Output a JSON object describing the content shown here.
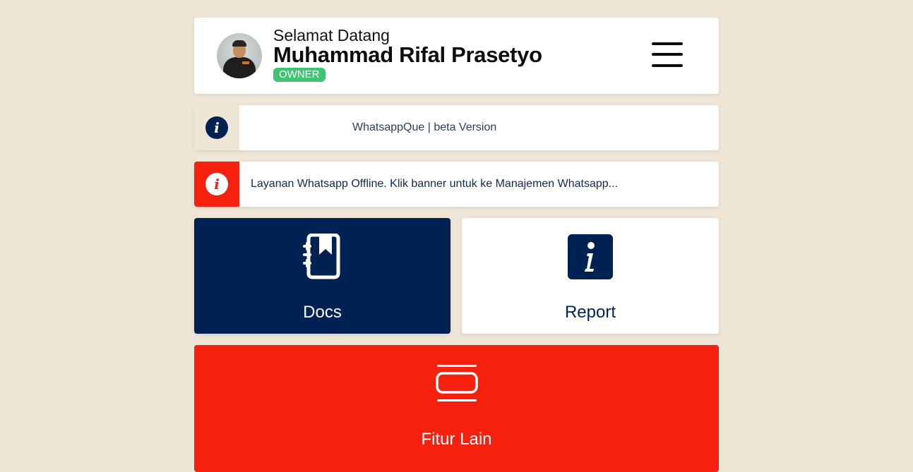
{
  "header": {
    "greeting": "Selamat Datang",
    "user_name": "Muhammad Rifal Prasetyo",
    "role_badge": "OWNER",
    "avatar_icon": "user-avatar",
    "menu_icon": "hamburger-menu-icon"
  },
  "info_banner": {
    "icon": "info-icon",
    "text": "WhatsappQue | beta Version",
    "icon_bg": "#002253",
    "side_bg": "#efe5d6"
  },
  "alert_banner": {
    "icon": "info-icon",
    "text": "Layanan Whatsapp Offline. Klik banner untuk ke Manajemen Whatsapp...",
    "side_bg": "#f5200e"
  },
  "tiles": [
    {
      "label": "Docs",
      "icon": "notebook-bookmark-icon",
      "bg": "#002253",
      "fg": "#ffffff"
    },
    {
      "label": "Report",
      "icon": "info-square-icon",
      "bg": "#ffffff",
      "fg": "#002253"
    }
  ],
  "wide_tile": {
    "label": "Fitur Lain",
    "icon": "carousel-icon",
    "bg": "#f5200e",
    "fg": "#ffffff"
  },
  "colors": {
    "page_bg": "#efe5d6",
    "navy": "#002253",
    "red": "#f5200e",
    "green": "#3ec474"
  }
}
